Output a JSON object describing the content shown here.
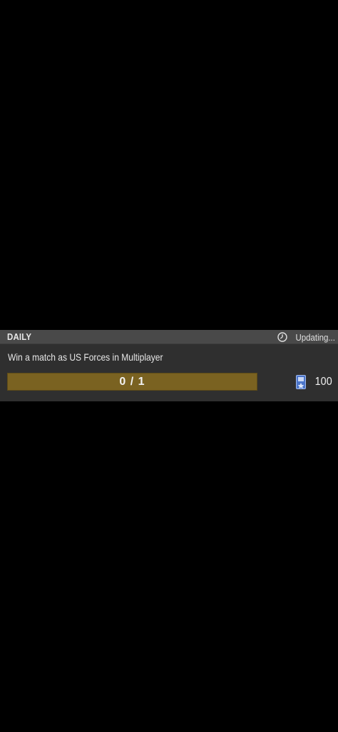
{
  "challenge": {
    "category": "DAILY",
    "status": "Updating...",
    "description": "Win a match as US Forces in Multiplayer",
    "progress": {
      "label": "0 / 1",
      "current": 0,
      "target": 1
    },
    "reward": {
      "icon": "medal-icon",
      "amount": "100"
    }
  },
  "colors": {
    "background": "#000000",
    "card": "#2f2f2f",
    "header": "#494949",
    "progress_track": "#7a6221",
    "progress_fill": "#c9a23c",
    "reward_icon": "#4a74c9"
  }
}
